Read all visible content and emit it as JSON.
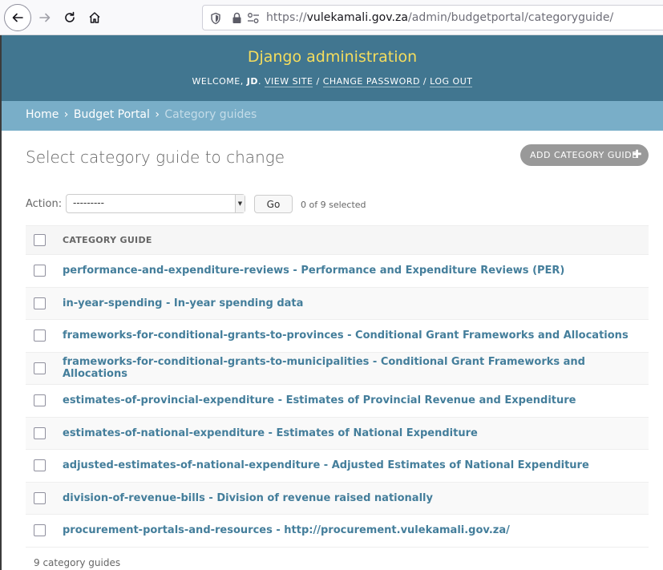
{
  "browser": {
    "url_prefix": "https://",
    "url_domain": "vulekamali.gov.za",
    "url_path": "/admin/budgetportal/categoryguide/"
  },
  "header": {
    "branding": "Django administration",
    "welcome": "WELCOME,",
    "user": "JD",
    "view_site": "VIEW SITE",
    "change_password": "CHANGE PASSWORD",
    "log_out": "LOG OUT"
  },
  "breadcrumbs": {
    "home": "Home",
    "app": "Budget Portal",
    "current": "Category guides"
  },
  "main": {
    "title": "Select category guide to change",
    "add_button": "ADD CATEGORY GUIDE",
    "action_label": "Action:",
    "action_selected": "---------",
    "go_label": "Go",
    "selection_counter": "0 of 9 selected",
    "column_header": "CATEGORY GUIDE",
    "rows": [
      "performance-and-expenditure-reviews - Performance and Expenditure Reviews (PER)",
      "in-year-spending - In-year spending data",
      "frameworks-for-conditional-grants-to-provinces - Conditional Grant Frameworks and Allocations",
      "frameworks-for-conditional-grants-to-municipalities - Conditional Grant Frameworks and Allocations",
      "estimates-of-provincial-expenditure - Estimates of Provincial Revenue and Expenditure",
      "estimates-of-national-expenditure - Estimates of National Expenditure",
      "adjusted-estimates-of-national-expenditure - Adjusted Estimates of National Expenditure",
      "division-of-revenue-bills - Division of revenue raised nationally",
      "procurement-portals-and-resources - http://procurement.vulekamali.gov.za/"
    ],
    "paginator": "9 category guides"
  },
  "colors": {
    "header_bg": "#417690",
    "branding": "#f5dd5d",
    "breadcrumbs_bg": "#79aec8",
    "link": "#447e9b"
  }
}
